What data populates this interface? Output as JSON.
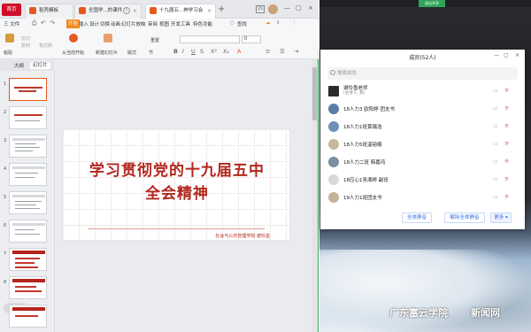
{
  "app": {
    "home_tab": "首页",
    "tabs": [
      {
        "label": "稻壳模板"
      },
      {
        "label": "全国学...的课件"
      },
      {
        "label": "十九届五...神学习会"
      }
    ],
    "tab_count_badge": "25"
  },
  "menu": {
    "file": "三 文件",
    "items": [
      "开始",
      "插入",
      "设计",
      "切换",
      "动画",
      "幻灯片放映",
      "审阅",
      "视图",
      "开发工具",
      "特色功能"
    ],
    "search": "查找"
  },
  "toolbar": {
    "paste": "粘贴",
    "cut": "剪切",
    "copy": "复制",
    "format_painter": "格式刷",
    "from_current": "从当前开始",
    "new_slide": "新建幻灯片",
    "layout": "版式",
    "section": "节",
    "reset": "重置",
    "font_value": "",
    "font_size": "0"
  },
  "sidepanel": {
    "tab_outline": "大纲",
    "tab_slides": "幻灯片",
    "slides": [
      {
        "num": "1"
      },
      {
        "num": "2"
      },
      {
        "num": "3"
      },
      {
        "num": "4"
      },
      {
        "num": "5"
      },
      {
        "num": "6"
      },
      {
        "num": "7"
      },
      {
        "num": "8"
      },
      {
        "num": "9"
      }
    ],
    "zoom_badge": "Q"
  },
  "slide": {
    "title_line1": "学习贯彻党的十九届五中",
    "title_line2": "全会精神",
    "footer": "社会与公共管理学院  谢怜盈"
  },
  "top_right": {
    "button": "退出共享"
  },
  "panel": {
    "title": "成员(52人)",
    "search_placeholder": "搜索成员",
    "members": [
      {
        "name": "谢怜盈老师",
        "role": "(主持人, 我)",
        "color": "#2b2b2b"
      },
      {
        "name": "18人力3 欧阳婷 团支书",
        "role": "",
        "color": "#5b7ea8"
      },
      {
        "name": "18人力1班黄璐浩",
        "role": "",
        "color": "#6d8fb3"
      },
      {
        "name": "18人力5班温韬楠",
        "role": "",
        "color": "#c8b89a"
      },
      {
        "name": "18人力二班 韩嘉鸿",
        "role": "",
        "color": "#7c8ea3"
      },
      {
        "name": "18应心1吴湘婷 副班",
        "role": "",
        "color": "#d9d9d9"
      },
      {
        "name": "19人力1班团支书",
        "role": "",
        "color": "#c7b295"
      }
    ],
    "buttons": {
      "mute_all": "全体静音",
      "unmute_all": "解除全体静音",
      "more": "更多 ▾"
    }
  },
  "watermark": {
    "left": "广东富云学院",
    "right": "新闻网"
  }
}
